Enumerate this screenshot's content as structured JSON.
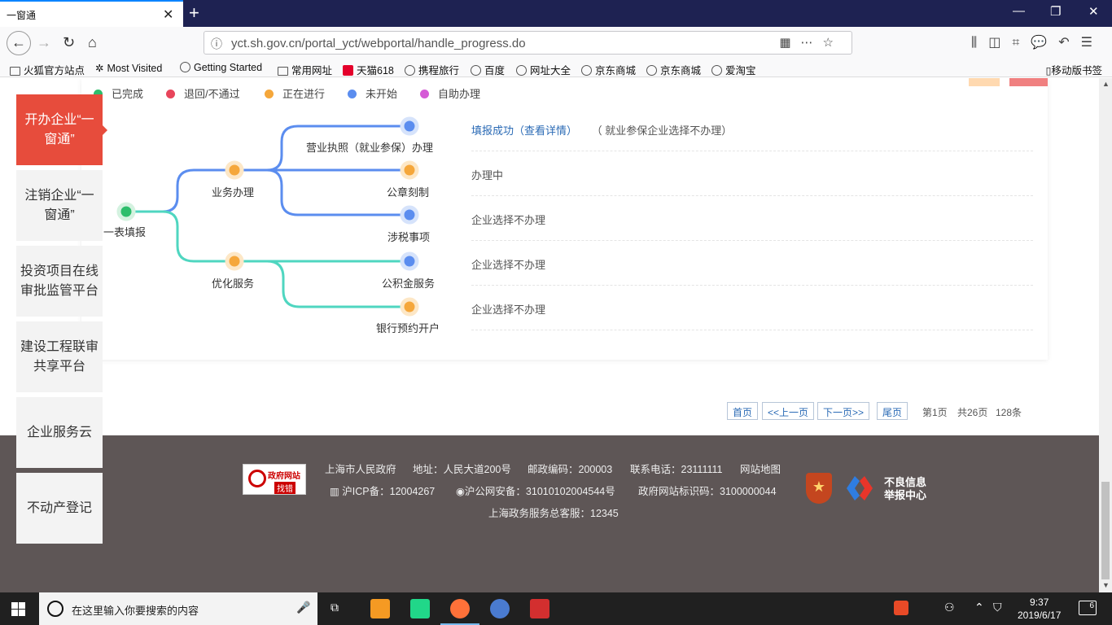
{
  "browser": {
    "tab_title": "一窗通",
    "url": "yct.sh.gov.cn/portal_yct/webportal/handle_progress.do",
    "bookmarks": [
      "火狐官方站点",
      "Most Visited",
      "Getting Started",
      "常用网址",
      "天猫618",
      "携程旅行",
      "百度",
      "网址大全",
      "京东商城",
      "京东商城",
      "爱淘宝"
    ],
    "mobile_bookmarks": "移动版书签"
  },
  "legend": [
    {
      "label": "已完成",
      "color": "#2dbe6c"
    },
    {
      "label": "退回/不通过",
      "color": "#e8455b"
    },
    {
      "label": "正在进行",
      "color": "#f5a73b"
    },
    {
      "label": "未开始",
      "color": "#5b8def"
    },
    {
      "label": "自助办理",
      "color": "#d55bd6"
    }
  ],
  "flow": {
    "root": "一表填报",
    "branch1": "业务办理",
    "branch2": "优化服务",
    "leaf_license": "营业执照（就业参保）办理",
    "leaf_seal": "公章刻制",
    "leaf_tax": "涉税事项",
    "leaf_fund": "公积金服务",
    "leaf_bank": "银行预约开户"
  },
  "statuses": {
    "license_link": "填报成功（查看详情）",
    "license_note": "（ 就业参保企业选择不办理）",
    "seal": "办理中",
    "tax": "企业选择不办理",
    "fund": "企业选择不办理",
    "bank": "企业选择不办理"
  },
  "sidenav": [
    {
      "label": "开办企业“一窗通”",
      "active": true
    },
    {
      "label": "注销企业“一窗通”",
      "active": false
    },
    {
      "label": "投资项目在线审批监管平台",
      "active": false
    },
    {
      "label": "建设工程联审共享平台",
      "active": false
    },
    {
      "label": "企业服务云",
      "active": false
    },
    {
      "label": "不动产登记",
      "active": false
    }
  ],
  "pager": {
    "first": "首页",
    "prev": "<<上一页",
    "next": "下一页>>",
    "last": "尾页",
    "current": "第1页",
    "total_pages": "共26页",
    "total_items": "128条"
  },
  "footer": {
    "badge_title": "政府网站",
    "badge_action": "找错",
    "links": [
      "上海市人民政府",
      "地址：人民大道200号",
      "邮政编码：200003",
      "联系电话：23111111",
      "网站地图"
    ],
    "icp": "沪ICP备：12004267",
    "police": "沪公网安备：31010102004544号",
    "site_id": "政府网站标识码：3100000044",
    "hotline": "上海政务服务总客服：12345",
    "report_line1": "不良信息",
    "report_line2": "举报中心"
  },
  "taskbar": {
    "search_placeholder": "在这里输入你要搜索的内容",
    "time": "9:37",
    "date": "2019/6/17",
    "notifications": "6"
  }
}
